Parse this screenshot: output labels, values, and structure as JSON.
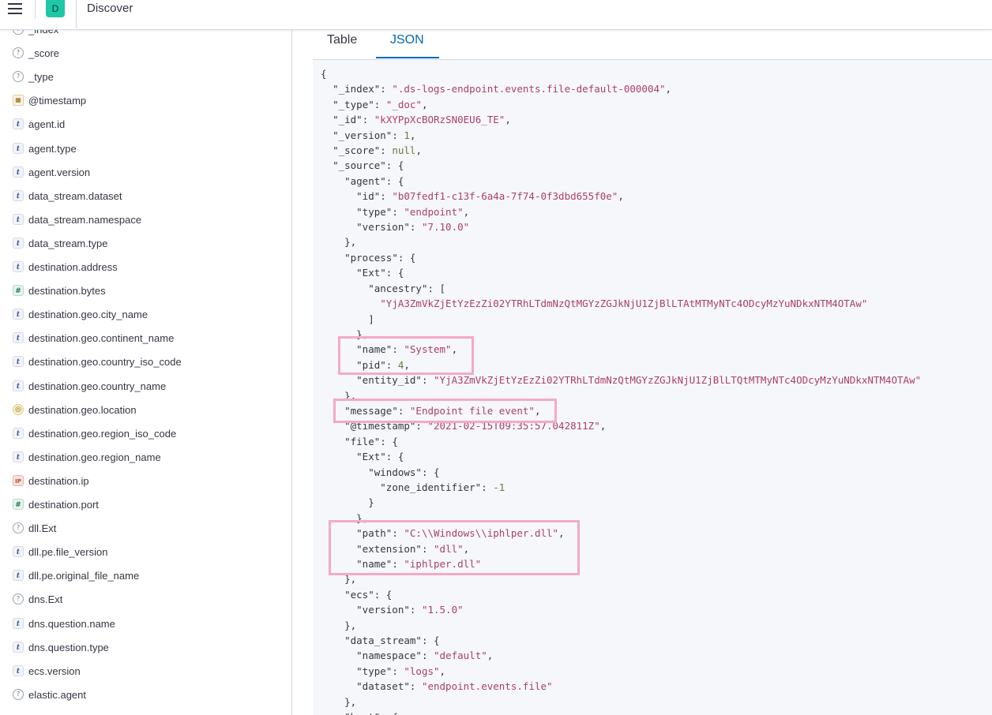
{
  "header": {
    "space_initial": "D",
    "breadcrumb": "Discover"
  },
  "sidebar": {
    "fields": [
      {
        "name": "_index",
        "type": "q"
      },
      {
        "name": "_score",
        "type": "q"
      },
      {
        "name": "_type",
        "type": "q"
      },
      {
        "name": "@timestamp",
        "type": "d"
      },
      {
        "name": "agent.id",
        "type": "t"
      },
      {
        "name": "agent.type",
        "type": "t"
      },
      {
        "name": "agent.version",
        "type": "t"
      },
      {
        "name": "data_stream.dataset",
        "type": "t"
      },
      {
        "name": "data_stream.namespace",
        "type": "t"
      },
      {
        "name": "data_stream.type",
        "type": "t"
      },
      {
        "name": "destination.address",
        "type": "t"
      },
      {
        "name": "destination.bytes",
        "type": "n"
      },
      {
        "name": "destination.geo.city_name",
        "type": "t"
      },
      {
        "name": "destination.geo.continent_name",
        "type": "t"
      },
      {
        "name": "destination.geo.country_iso_code",
        "type": "t"
      },
      {
        "name": "destination.geo.country_name",
        "type": "t"
      },
      {
        "name": "destination.geo.location",
        "type": "geo"
      },
      {
        "name": "destination.geo.region_iso_code",
        "type": "t"
      },
      {
        "name": "destination.geo.region_name",
        "type": "t"
      },
      {
        "name": "destination.ip",
        "type": "ip"
      },
      {
        "name": "destination.port",
        "type": "n"
      },
      {
        "name": "dll.Ext",
        "type": "q"
      },
      {
        "name": "dll.pe.file_version",
        "type": "t"
      },
      {
        "name": "dll.pe.original_file_name",
        "type": "t"
      },
      {
        "name": "dns.Ext",
        "type": "q"
      },
      {
        "name": "dns.question.name",
        "type": "t"
      },
      {
        "name": "dns.question.type",
        "type": "t"
      },
      {
        "name": "ecs.version",
        "type": "t"
      },
      {
        "name": "elastic.agent",
        "type": "q"
      }
    ]
  },
  "main": {
    "tabs": [
      {
        "label": "Table",
        "active": false
      },
      {
        "label": "JSON",
        "active": true
      }
    ],
    "json_lines": [
      [
        [
          "p",
          "{"
        ]
      ],
      [
        [
          "p",
          "  "
        ],
        [
          "k",
          "\"_index\""
        ],
        [
          "p",
          ": "
        ],
        [
          "s",
          "\".ds-logs-endpoint.events.file-default-000004\""
        ],
        [
          "p",
          ","
        ]
      ],
      [
        [
          "p",
          "  "
        ],
        [
          "k",
          "\"_type\""
        ],
        [
          "p",
          ": "
        ],
        [
          "s",
          "\"_doc\""
        ],
        [
          "p",
          ","
        ]
      ],
      [
        [
          "p",
          "  "
        ],
        [
          "k",
          "\"_id\""
        ],
        [
          "p",
          ": "
        ],
        [
          "s",
          "\"kXYPpXcBORzSN0EU6_TE\""
        ],
        [
          "p",
          ","
        ]
      ],
      [
        [
          "p",
          "  "
        ],
        [
          "k",
          "\"_version\""
        ],
        [
          "p",
          ": "
        ],
        [
          "v",
          "1"
        ],
        [
          "p",
          ","
        ]
      ],
      [
        [
          "p",
          "  "
        ],
        [
          "k",
          "\"_score\""
        ],
        [
          "p",
          ": "
        ],
        [
          "v",
          "null"
        ],
        [
          "p",
          ","
        ]
      ],
      [
        [
          "p",
          "  "
        ],
        [
          "k",
          "\"_source\""
        ],
        [
          "p",
          ": {"
        ]
      ],
      [
        [
          "p",
          "    "
        ],
        [
          "k",
          "\"agent\""
        ],
        [
          "p",
          ": {"
        ]
      ],
      [
        [
          "p",
          "      "
        ],
        [
          "k",
          "\"id\""
        ],
        [
          "p",
          ": "
        ],
        [
          "s",
          "\"b07fedf1-c13f-6a4a-7f74-0f3dbd655f0e\""
        ],
        [
          "p",
          ","
        ]
      ],
      [
        [
          "p",
          "      "
        ],
        [
          "k",
          "\"type\""
        ],
        [
          "p",
          ": "
        ],
        [
          "s",
          "\"endpoint\""
        ],
        [
          "p",
          ","
        ]
      ],
      [
        [
          "p",
          "      "
        ],
        [
          "k",
          "\"version\""
        ],
        [
          "p",
          ": "
        ],
        [
          "s",
          "\"7.10.0\""
        ]
      ],
      [
        [
          "p",
          "    },"
        ]
      ],
      [
        [
          "p",
          "    "
        ],
        [
          "k",
          "\"process\""
        ],
        [
          "p",
          ": {"
        ]
      ],
      [
        [
          "p",
          "      "
        ],
        [
          "k",
          "\"Ext\""
        ],
        [
          "p",
          ": {"
        ]
      ],
      [
        [
          "p",
          "        "
        ],
        [
          "k",
          "\"ancestry\""
        ],
        [
          "p",
          ": ["
        ]
      ],
      [
        [
          "p",
          "          "
        ],
        [
          "s",
          "\"YjA3ZmVkZjEtYzEzZi02YTRhLTdmNzQtMGYzZGJkNjU1ZjBlLTAtMTMyNTc4ODcyMzYuNDkxNTM4OTAw\""
        ]
      ],
      [
        [
          "p",
          "        ]"
        ]
      ],
      [
        [
          "p",
          "      },"
        ]
      ],
      [
        [
          "p",
          "      "
        ],
        [
          "k",
          "\"name\""
        ],
        [
          "p",
          ": "
        ],
        [
          "s",
          "\"System\""
        ],
        [
          "p",
          ","
        ]
      ],
      [
        [
          "p",
          "      "
        ],
        [
          "k",
          "\"pid\""
        ],
        [
          "p",
          ": "
        ],
        [
          "v",
          "4"
        ],
        [
          "p",
          ","
        ]
      ],
      [
        [
          "p",
          "      "
        ],
        [
          "k",
          "\"entity_id\""
        ],
        [
          "p",
          ": "
        ],
        [
          "s",
          "\"YjA3ZmVkZjEtYzEzZi02YTRhLTdmNzQtMGYzZGJkNjU1ZjBlLTQtMTMyNTc4ODcyMzYuNDkxNTM4OTAw\""
        ]
      ],
      [
        [
          "p",
          "    },"
        ]
      ],
      [
        [
          "p",
          "    "
        ],
        [
          "k",
          "\"message\""
        ],
        [
          "p",
          ": "
        ],
        [
          "s",
          "\"Endpoint file event\""
        ],
        [
          "p",
          ","
        ]
      ],
      [
        [
          "p",
          "    "
        ],
        [
          "k",
          "\"@timestamp\""
        ],
        [
          "p",
          ": "
        ],
        [
          "s",
          "\"2021-02-15T09:35:57.042811Z\""
        ],
        [
          "p",
          ","
        ]
      ],
      [
        [
          "p",
          "    "
        ],
        [
          "k",
          "\"file\""
        ],
        [
          "p",
          ": {"
        ]
      ],
      [
        [
          "p",
          "      "
        ],
        [
          "k",
          "\"Ext\""
        ],
        [
          "p",
          ": {"
        ]
      ],
      [
        [
          "p",
          "        "
        ],
        [
          "k",
          "\"windows\""
        ],
        [
          "p",
          ": {"
        ]
      ],
      [
        [
          "p",
          "          "
        ],
        [
          "k",
          "\"zone_identifier\""
        ],
        [
          "p",
          ": "
        ],
        [
          "v",
          "-1"
        ]
      ],
      [
        [
          "p",
          "        }"
        ]
      ],
      [
        [
          "p",
          "      },"
        ]
      ],
      [
        [
          "p",
          "      "
        ],
        [
          "k",
          "\"path\""
        ],
        [
          "p",
          ": "
        ],
        [
          "s",
          "\"C:\\\\Windows\\\\iphlper.dll\""
        ],
        [
          "p",
          ","
        ]
      ],
      [
        [
          "p",
          "      "
        ],
        [
          "k",
          "\"extension\""
        ],
        [
          "p",
          ": "
        ],
        [
          "s",
          "\"dll\""
        ],
        [
          "p",
          ","
        ]
      ],
      [
        [
          "p",
          "      "
        ],
        [
          "k",
          "\"name\""
        ],
        [
          "p",
          ": "
        ],
        [
          "s",
          "\"iphlper.dll\""
        ]
      ],
      [
        [
          "p",
          "    },"
        ]
      ],
      [
        [
          "p",
          "    "
        ],
        [
          "k",
          "\"ecs\""
        ],
        [
          "p",
          ": {"
        ]
      ],
      [
        [
          "p",
          "      "
        ],
        [
          "k",
          "\"version\""
        ],
        [
          "p",
          ": "
        ],
        [
          "s",
          "\"1.5.0\""
        ]
      ],
      [
        [
          "p",
          "    },"
        ]
      ],
      [
        [
          "p",
          "    "
        ],
        [
          "k",
          "\"data_stream\""
        ],
        [
          "p",
          ": {"
        ]
      ],
      [
        [
          "p",
          "      "
        ],
        [
          "k",
          "\"namespace\""
        ],
        [
          "p",
          ": "
        ],
        [
          "s",
          "\"default\""
        ],
        [
          "p",
          ","
        ]
      ],
      [
        [
          "p",
          "      "
        ],
        [
          "k",
          "\"type\""
        ],
        [
          "p",
          ": "
        ],
        [
          "s",
          "\"logs\""
        ],
        [
          "p",
          ","
        ]
      ],
      [
        [
          "p",
          "      "
        ],
        [
          "k",
          "\"dataset\""
        ],
        [
          "p",
          ": "
        ],
        [
          "s",
          "\"endpoint.events.file\""
        ]
      ],
      [
        [
          "p",
          "    },"
        ]
      ],
      [
        [
          "p",
          "    "
        ],
        [
          "k",
          "\"host\""
        ],
        [
          "p",
          ": {"
        ]
      ]
    ]
  },
  "colors": {
    "accent": "#006bb8",
    "highlight_box": "#f4a9c8",
    "json_string": "#ac3e6e",
    "json_value": "#6a7a3a"
  }
}
